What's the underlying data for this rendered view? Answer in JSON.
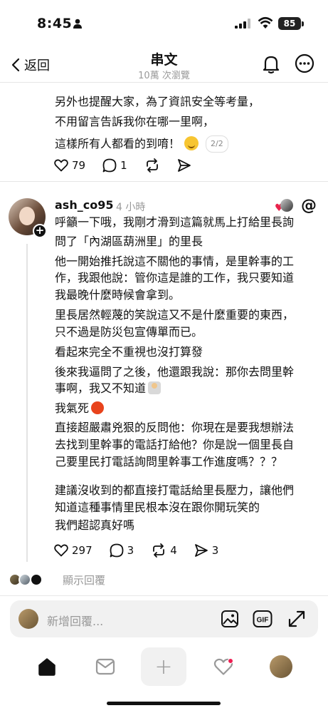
{
  "status_bar": {
    "time": "8:45",
    "battery": "85"
  },
  "header": {
    "back_label": "返回",
    "title": "串文",
    "subtitle": "10萬 次瀏覽"
  },
  "previous_post": {
    "lines": [
      "另外也提醒大家，為了資訊安全等考量，",
      "不用留言告訴我你在哪一里啊，",
      "這樣所有人都看的到唷！"
    ],
    "page_indicator": "2/2",
    "likes": "79",
    "comments": "1"
  },
  "reply": {
    "username": "ash_co95",
    "time": "4 小時",
    "lines": [
      "呼籲一下哦，我剛才滑到這篇就馬上打給里長詢",
      "問了「內湖區葫洲里」的里長",
      "他一開始推托說這不關他的事情，是里幹事的工",
      "作，我跟他說：管你這是誰的工作，我只要知道",
      "我最晚什麼時候會拿到。",
      "里長居然輕蔑的笑說這又不是什麼重要的東西，",
      "只不過是防災包宣傳單而已。",
      "看起來完全不重視也沒打算發",
      "後來我逼問了之後，他還跟我說：那你去問里幹",
      "事啊，我又不知道",
      "我氣死",
      "直接超嚴肅兇狠的反問他：你現在是要我想辦法",
      "去找到里幹事的電話打給他？你是說一個里長自",
      "己要里民打電話詢問里幹事工作進度嗎？？？",
      "建議沒收到的都直接打電話給里長壓力，讓他們",
      "知道這種事情里民根本沒在跟你開玩笑的",
      "我們超認真好嗎"
    ],
    "likes": "297",
    "comments": "3",
    "reposts": "4",
    "shares": "3"
  },
  "show_replies_label": "顯示回覆",
  "composer": {
    "placeholder": "新增回覆..."
  },
  "colors": {
    "accent_red": "#ee1d52",
    "muted": "#999999"
  }
}
